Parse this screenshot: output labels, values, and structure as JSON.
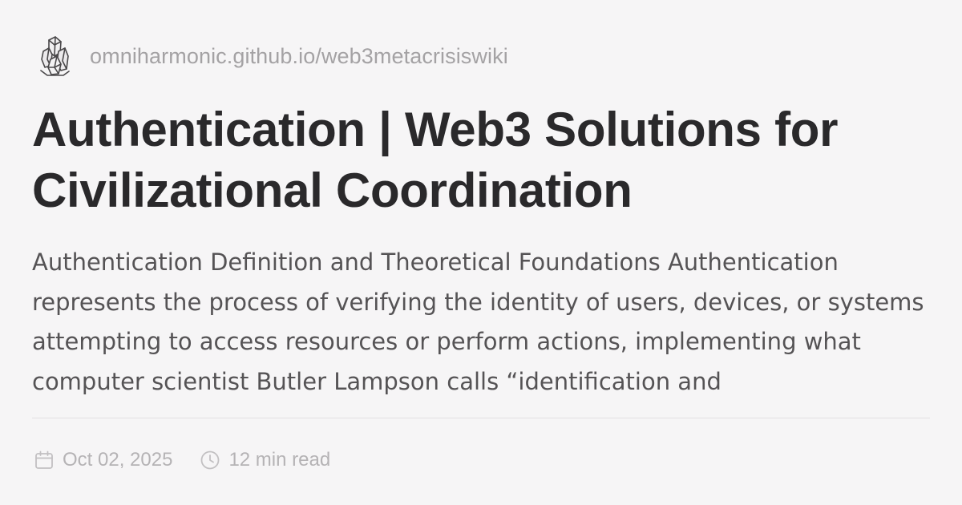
{
  "site": {
    "logo_icon": "crystal-logo-icon",
    "url": "omniharmonic.github.io/web3metacrisiswiki"
  },
  "article": {
    "title": "Authentication | Web3 Solutions for Civilizational Coordination",
    "excerpt": "Authentication Definition and Theoretical Foundations Authentication represents the process of verifying the identity of users, devices, or systems attempting to access resources or perform actions, implementing what computer scientist Butler Lampson calls “identification and"
  },
  "meta": {
    "date_icon": "calendar-icon",
    "date": "Oct 02, 2025",
    "read_icon": "clock-icon",
    "read_time": "12 min read"
  },
  "colors": {
    "background": "#f6f5f6",
    "title": "#2a292b",
    "body": "#555355",
    "muted": "#a4a2a4"
  }
}
